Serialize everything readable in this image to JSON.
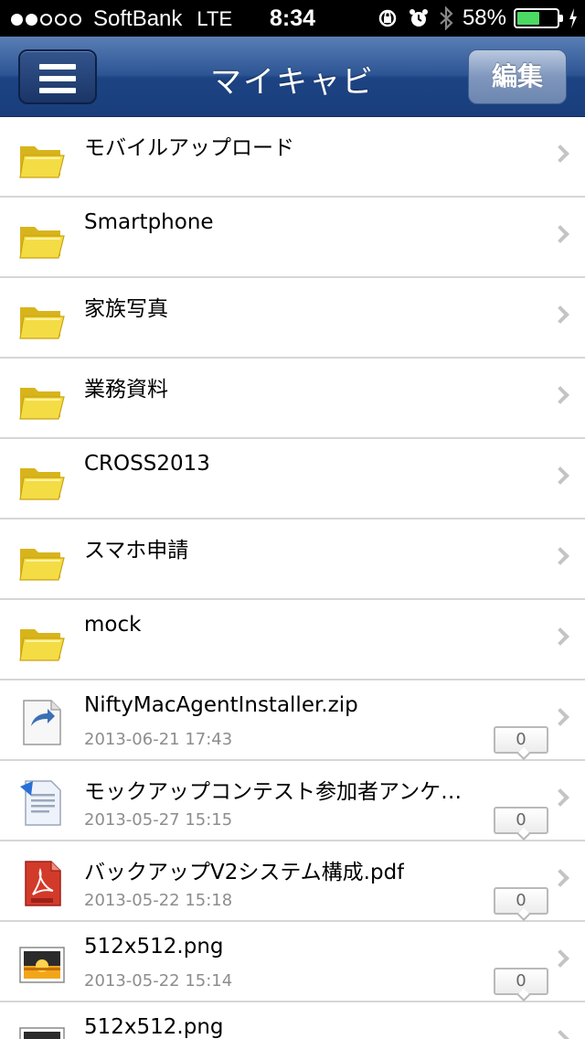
{
  "status_bar": {
    "carrier": "SoftBank",
    "network": "LTE",
    "time": "8:34",
    "battery_percent_label": "58%",
    "battery_level": 0.58,
    "signal_bars_filled": 2,
    "signal_bars_total": 5,
    "battery_color": "#4cd964"
  },
  "nav": {
    "title": "マイキャビ",
    "edit_label": "編集",
    "menu_icon": "hamburger-menu-icon"
  },
  "items": [
    {
      "type": "folder",
      "title": "モバイルアップロード"
    },
    {
      "type": "folder",
      "title": "Smartphone"
    },
    {
      "type": "folder",
      "title": "家族写真"
    },
    {
      "type": "folder",
      "title": "業務資料"
    },
    {
      "type": "folder",
      "title": "CROSS2013"
    },
    {
      "type": "folder",
      "title": "スマホ申請"
    },
    {
      "type": "folder",
      "title": "mock"
    },
    {
      "type": "zip",
      "title": "NiftyMacAgentInstaller.zip",
      "date": "2013-06-21 17:43",
      "comments": "0"
    },
    {
      "type": "doc",
      "title": "モックアップコンテスト参加者アンケ…",
      "date": "2013-05-27 15:15",
      "comments": "0"
    },
    {
      "type": "pdf",
      "title": "バックアップV2システム構成.pdf",
      "date": "2013-05-22 15:18",
      "comments": "0"
    },
    {
      "type": "image",
      "title": "512x512.png",
      "date": "2013-05-22 15:14",
      "comments": "0"
    },
    {
      "type": "image",
      "title": "512x512.png"
    }
  ]
}
